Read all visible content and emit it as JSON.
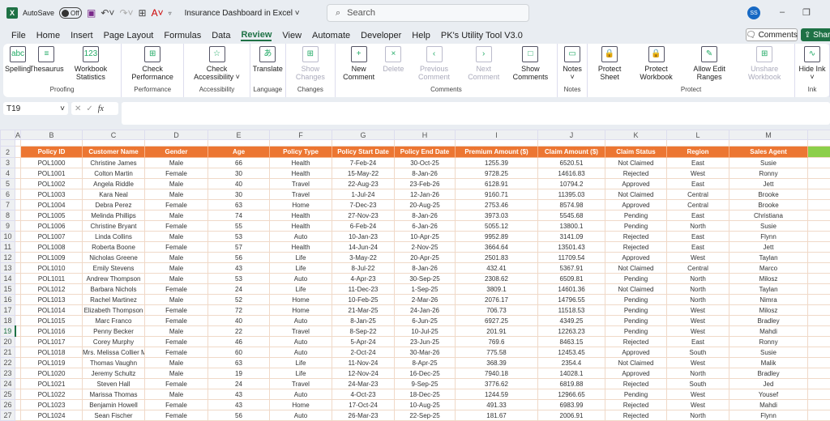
{
  "titlebar": {
    "autosave": "AutoSave",
    "toggle": "Off",
    "title": "Insurance Dashboard in Excel",
    "search": "Search",
    "avatar": "SS"
  },
  "menu": [
    "File",
    "Home",
    "Insert",
    "Page Layout",
    "Formulas",
    "Data",
    "Review",
    "View",
    "Automate",
    "Developer",
    "Help",
    "PK's Utility Tool V3.0"
  ],
  "active_menu": "Review",
  "buttons": {
    "comments": "Comments",
    "share": "Share"
  },
  "ribbon": [
    {
      "label": "Proofing",
      "items": [
        {
          "t": "Spelling",
          "i": "abc"
        },
        {
          "t": "Thesaurus",
          "i": "≡"
        },
        {
          "t": "Workbook Statistics",
          "i": "123"
        }
      ]
    },
    {
      "label": "Performance",
      "items": [
        {
          "t": "Check Performance",
          "i": "⊞"
        }
      ]
    },
    {
      "label": "Accessibility",
      "items": [
        {
          "t": "Check Accessibility ˅",
          "i": "☆"
        }
      ]
    },
    {
      "label": "Language",
      "items": [
        {
          "t": "Translate",
          "i": "あ"
        }
      ]
    },
    {
      "label": "Changes",
      "items": [
        {
          "t": "Show Changes",
          "i": "⊞",
          "d": true
        }
      ]
    },
    {
      "label": "Comments",
      "items": [
        {
          "t": "New Comment",
          "i": "+"
        },
        {
          "t": "Delete",
          "i": "×",
          "d": true
        },
        {
          "t": "Previous Comment",
          "i": "‹",
          "d": true
        },
        {
          "t": "Next Comment",
          "i": "›",
          "d": true
        },
        {
          "t": "Show Comments",
          "i": "□"
        }
      ]
    },
    {
      "label": "Notes",
      "items": [
        {
          "t": "Notes ˅",
          "i": "▭"
        }
      ]
    },
    {
      "label": "Protect",
      "items": [
        {
          "t": "Protect Sheet",
          "i": "🔒"
        },
        {
          "t": "Protect Workbook",
          "i": "🔒"
        },
        {
          "t": "Allow Edit Ranges",
          "i": "✎"
        },
        {
          "t": "Unshare Workbook",
          "i": "⊞",
          "d": true
        }
      ]
    },
    {
      "label": "Ink",
      "items": [
        {
          "t": "Hide Ink ˅",
          "i": "∿"
        }
      ]
    }
  ],
  "formula_bar": {
    "name_box": "T19",
    "fx": "fx",
    "value": ""
  },
  "columns": [
    "A",
    "B",
    "C",
    "D",
    "E",
    "F",
    "G",
    "H",
    "I",
    "J",
    "K",
    "L",
    "M",
    ""
  ],
  "headers": [
    "Policy ID",
    "Customer Name",
    "Gender",
    "Age",
    "Policy Type",
    "Policy Start Date",
    "Policy End Date",
    "Premium Amount ($)",
    "Claim Amount ($)",
    "Claim Status",
    "Region",
    "Sales Agent"
  ],
  "rows": [
    [
      "POL1000",
      "Christine James",
      "Male",
      "66",
      "Health",
      "7-Feb-24",
      "30-Oct-25",
      "1255.39",
      "6520.51",
      "Not Claimed",
      "East",
      "Susie"
    ],
    [
      "POL1001",
      "Colton Martin",
      "Female",
      "30",
      "Health",
      "15-May-22",
      "8-Jan-26",
      "9728.25",
      "14616.83",
      "Rejected",
      "West",
      "Ronny"
    ],
    [
      "POL1002",
      "Angela Riddle",
      "Male",
      "40",
      "Travel",
      "22-Aug-23",
      "23-Feb-26",
      "6128.91",
      "10794.2",
      "Approved",
      "East",
      "Jett"
    ],
    [
      "POL1003",
      "Kara Neal",
      "Male",
      "30",
      "Travel",
      "1-Jul-24",
      "12-Jan-26",
      "9160.71",
      "11395.03",
      "Not Claimed",
      "Central",
      "Brooke"
    ],
    [
      "POL1004",
      "Debra Perez",
      "Female",
      "63",
      "Home",
      "7-Dec-23",
      "20-Aug-25",
      "2753.46",
      "8574.98",
      "Approved",
      "Central",
      "Brooke"
    ],
    [
      "POL1005",
      "Melinda Phillips",
      "Male",
      "74",
      "Health",
      "27-Nov-23",
      "8-Jan-26",
      "3973.03",
      "5545.68",
      "Pending",
      "East",
      "Christiana"
    ],
    [
      "POL1006",
      "Christine Bryant",
      "Female",
      "55",
      "Health",
      "6-Feb-24",
      "6-Jan-26",
      "5055.12",
      "13800.1",
      "Pending",
      "North",
      "Susie"
    ],
    [
      "POL1007",
      "Linda Collins",
      "Male",
      "53",
      "Auto",
      "10-Jan-23",
      "10-Apr-25",
      "9952.89",
      "3141.09",
      "Rejected",
      "East",
      "Flynn"
    ],
    [
      "POL1008",
      "Roberta Boone",
      "Female",
      "57",
      "Health",
      "14-Jun-24",
      "2-Nov-25",
      "3664.64",
      "13501.43",
      "Rejected",
      "East",
      "Jett"
    ],
    [
      "POL1009",
      "Nicholas Greene",
      "Male",
      "56",
      "Life",
      "3-May-22",
      "20-Apr-25",
      "2501.83",
      "11709.54",
      "Approved",
      "West",
      "Taylan"
    ],
    [
      "POL1010",
      "Emily Stevens",
      "Male",
      "43",
      "Life",
      "8-Jul-22",
      "8-Jan-26",
      "432.41",
      "5367.91",
      "Not Claimed",
      "Central",
      "Marco"
    ],
    [
      "POL1011",
      "Andrew Thompson",
      "Male",
      "53",
      "Auto",
      "4-Apr-23",
      "30-Sep-25",
      "2308.62",
      "6509.81",
      "Pending",
      "North",
      "Milosz"
    ],
    [
      "POL1012",
      "Barbara Nichols",
      "Female",
      "24",
      "Life",
      "11-Dec-23",
      "1-Sep-25",
      "3809.1",
      "14601.36",
      "Not Claimed",
      "North",
      "Taylan"
    ],
    [
      "POL1013",
      "Rachel Martinez",
      "Male",
      "52",
      "Home",
      "10-Feb-25",
      "2-Mar-26",
      "2076.17",
      "14796.55",
      "Pending",
      "North",
      "Nimra"
    ],
    [
      "POL1014",
      "Elizabeth Thompson",
      "Female",
      "72",
      "Home",
      "21-Mar-25",
      "24-Jan-26",
      "706.73",
      "11518.53",
      "Pending",
      "West",
      "Milosz"
    ],
    [
      "POL1015",
      "Marc Franco",
      "Female",
      "40",
      "Auto",
      "8-Jan-25",
      "6-Jun-25",
      "6927.25",
      "4349.25",
      "Pending",
      "West",
      "Bradley"
    ],
    [
      "POL1016",
      "Penny Becker",
      "Male",
      "22",
      "Travel",
      "8-Sep-22",
      "10-Jul-25",
      "201.91",
      "12263.23",
      "Pending",
      "West",
      "Mahdi"
    ],
    [
      "POL1017",
      "Corey Murphy",
      "Female",
      "46",
      "Auto",
      "5-Apr-24",
      "23-Jun-25",
      "769.6",
      "8463.15",
      "Rejected",
      "East",
      "Ronny"
    ],
    [
      "POL1018",
      "Mrs. Melissa Collier MD",
      "Female",
      "60",
      "Auto",
      "2-Oct-24",
      "30-Mar-26",
      "775.58",
      "12453.45",
      "Approved",
      "South",
      "Susie"
    ],
    [
      "POL1019",
      "Thomas Vaughn",
      "Male",
      "63",
      "Life",
      "11-Nov-24",
      "8-Apr-25",
      "368.39",
      "2354.4",
      "Not Claimed",
      "West",
      "Malik"
    ],
    [
      "POL1020",
      "Jeremy Schultz",
      "Male",
      "19",
      "Life",
      "12-Nov-24",
      "16-Dec-25",
      "7940.18",
      "14028.1",
      "Approved",
      "North",
      "Bradley"
    ],
    [
      "POL1021",
      "Steven Hall",
      "Female",
      "24",
      "Travel",
      "24-Mar-23",
      "9-Sep-25",
      "3776.62",
      "6819.88",
      "Rejected",
      "South",
      "Jed"
    ],
    [
      "POL1022",
      "Marissa Thomas",
      "Male",
      "43",
      "Auto",
      "4-Oct-23",
      "18-Dec-25",
      "1244.59",
      "12966.65",
      "Pending",
      "West",
      "Yousef"
    ],
    [
      "POL1023",
      "Benjamin Howell",
      "Female",
      "43",
      "Home",
      "17-Oct-24",
      "10-Aug-25",
      "491.33",
      "6983.99",
      "Rejected",
      "West",
      "Mahdi"
    ],
    [
      "POL1024",
      "Sean Fischer",
      "Female",
      "56",
      "Auto",
      "26-Mar-23",
      "22-Sep-25",
      "181.67",
      "2006.91",
      "Rejected",
      "North",
      "Flynn"
    ]
  ],
  "colors": {
    "header": "#ec7632",
    "accent": "#1e7145",
    "green_col": "#8ccf4a"
  }
}
